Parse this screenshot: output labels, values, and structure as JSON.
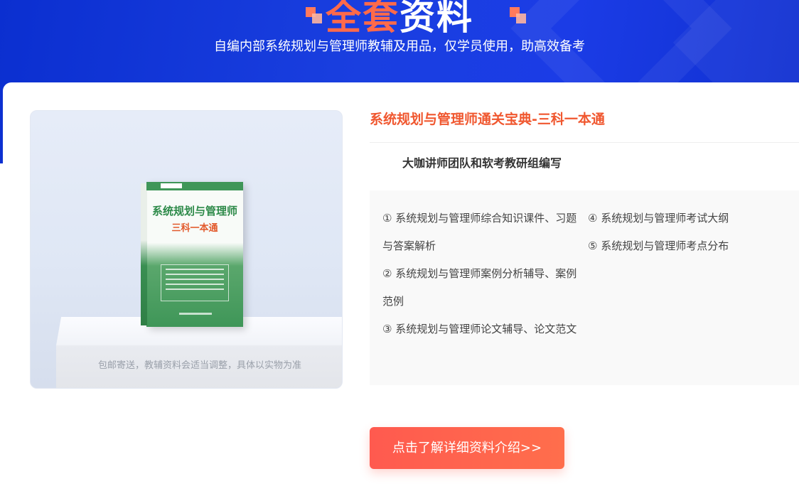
{
  "header": {
    "title_accent": "全套",
    "title_rest": "资料",
    "subtitle": "自编内部系统规划与管理师教辅及用品，仅学员使用，助高效备考"
  },
  "product": {
    "image_note": "包邮寄送，教辅资料会适当调整，具体以实物为准",
    "book_cover": {
      "title": "系统规划与管理师",
      "subtitle": "三科一本通"
    },
    "title": "系统规划与管理师通关宝典-三科一本通",
    "author": "大咖讲师团队和软考教研组编写",
    "contents_left": [
      "① 系统规划与管理师综合知识课件、习题与答案解析",
      "② 系统规划与管理师案例分析辅导、案例范例",
      "③ 系统规划与管理师论文辅导、论文范文"
    ],
    "contents_right": [
      "④ 系统规划与管理师考试大纲",
      "⑤ 系统规划与管理师考点分布"
    ],
    "cta_label": "点击了解详细资料介绍>>"
  },
  "colors": {
    "brand_blue": "#1a3fe0",
    "accent_orange": "#f0572f",
    "cta_red": "#ff5a4f"
  }
}
